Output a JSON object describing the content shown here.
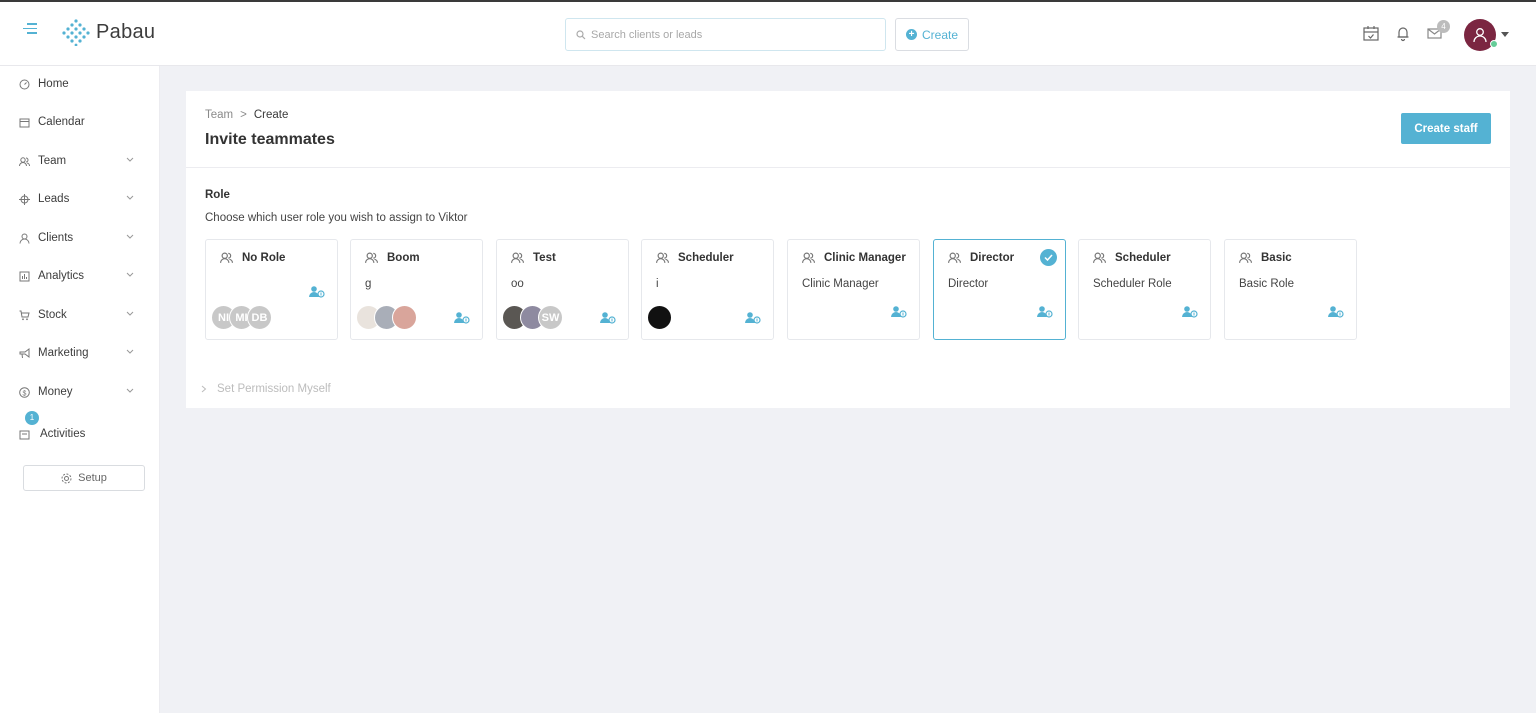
{
  "app": {
    "name": "Pabau"
  },
  "header": {
    "search_placeholder": "Search clients or leads",
    "create_label": "Create",
    "mail_badge": "4",
    "icons": [
      "calendar-check-icon",
      "bell-icon",
      "mail-icon"
    ]
  },
  "sidebar": {
    "items": [
      {
        "label": "Home",
        "icon": "dashboard-icon",
        "expandable": false
      },
      {
        "label": "Calendar",
        "icon": "calendar-icon",
        "expandable": false
      },
      {
        "label": "Team",
        "icon": "team-icon",
        "expandable": true
      },
      {
        "label": "Leads",
        "icon": "target-icon",
        "expandable": true
      },
      {
        "label": "Clients",
        "icon": "user-icon",
        "expandable": true
      },
      {
        "label": "Analytics",
        "icon": "chart-icon",
        "expandable": true
      },
      {
        "label": "Stock",
        "icon": "cart-icon",
        "expandable": true
      },
      {
        "label": "Marketing",
        "icon": "megaphone-icon",
        "expandable": true
      },
      {
        "label": "Money",
        "icon": "dollar-icon",
        "expandable": true
      },
      {
        "label": "Activities",
        "icon": "activities-icon",
        "expandable": false,
        "badge": "1"
      }
    ],
    "setup_label": "Setup"
  },
  "main": {
    "breadcrumb": {
      "parent": "Team",
      "separator": ">",
      "current": "Create"
    },
    "title": "Invite teammates",
    "create_staff_label": "Create staff",
    "role": {
      "heading": "Role",
      "description": "Choose which user role you wish to assign to Viktor",
      "cards": [
        {
          "name": "No Role",
          "subtitle": "",
          "selected": false,
          "avatars": [
            {
              "text": "NI",
              "color": "#c8c8c8"
            },
            {
              "text": "MI",
              "color": "#c8c8c8"
            },
            {
              "text": "DB",
              "color": "#c8c8c8"
            }
          ]
        },
        {
          "name": "Boom",
          "subtitle": "g",
          "selected": false,
          "avatars": [
            {
              "text": "",
              "color": "#e9e3dd"
            },
            {
              "text": "",
              "color": "#a9aeb8"
            },
            {
              "text": "",
              "color": "#d9a59b"
            }
          ]
        },
        {
          "name": "Test",
          "subtitle": "oo",
          "selected": false,
          "avatars": [
            {
              "text": "",
              "color": "#5a5753"
            },
            {
              "text": "",
              "color": "#8e8aa0"
            },
            {
              "text": "SW",
              "color": "#c8c8c8"
            }
          ]
        },
        {
          "name": "Scheduler",
          "subtitle": "i",
          "selected": false,
          "avatars": [
            {
              "text": "",
              "color": "#111111"
            }
          ]
        },
        {
          "name": "Clinic Manager",
          "subtitle": "Clinic Manager",
          "selected": false,
          "avatars": []
        },
        {
          "name": "Director",
          "subtitle": "Director",
          "selected": true,
          "avatars": []
        },
        {
          "name": "Scheduler",
          "subtitle": "Scheduler Role",
          "selected": false,
          "avatars": []
        },
        {
          "name": "Basic",
          "subtitle": "Basic Role",
          "selected": false,
          "avatars": []
        }
      ]
    },
    "permission_toggle": "Set Permission Myself"
  },
  "colors": {
    "accent": "#54b2d3",
    "avatar": "#7b2641",
    "online": "#65cd98",
    "background": "#f0f1f5"
  }
}
